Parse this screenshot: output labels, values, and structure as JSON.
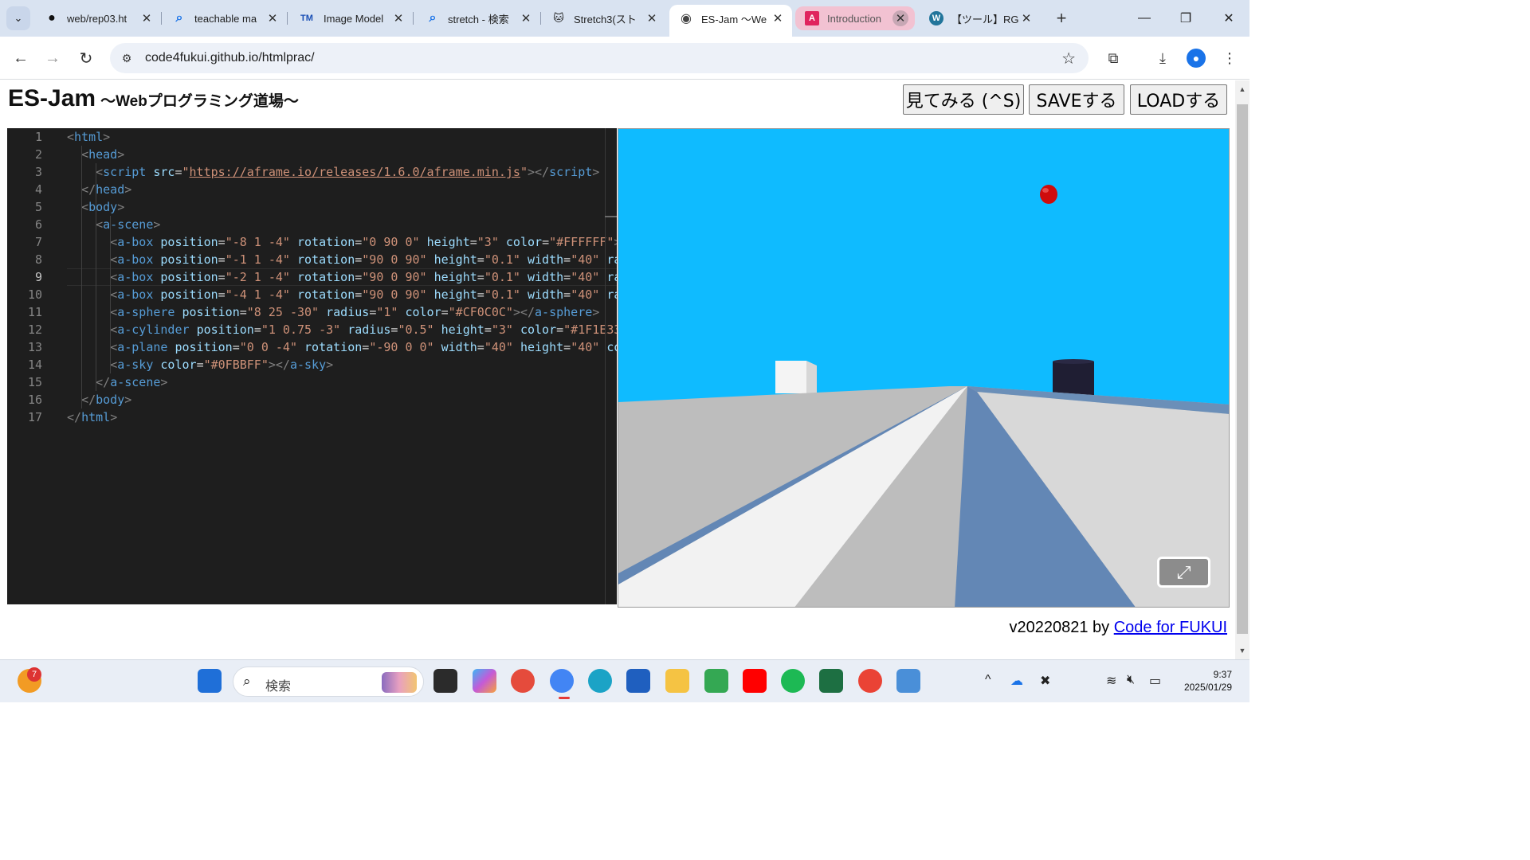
{
  "tabs": [
    {
      "title": "web/rep03.ht",
      "icon": "github-icon"
    },
    {
      "title": "teachable ma",
      "icon": "search-icon"
    },
    {
      "title": "Image Model",
      "icon": "tm-icon"
    },
    {
      "title": "stretch - 検索",
      "icon": "search-icon"
    },
    {
      "title": "Stretch3(スト",
      "icon": "scratch-cat-icon"
    },
    {
      "title": "ES-Jam 〜We",
      "icon": "globe-icon",
      "active": true
    },
    {
      "title": "Introduction",
      "icon": "angular-icon"
    },
    {
      "title": "【ツール】RGB",
      "icon": "wordpress-icon"
    }
  ],
  "tab_glyphs": {
    "github": "●",
    "search": "⌕",
    "tm": "TM",
    "scratch": "🐱",
    "globe": "◉",
    "angular": "A",
    "wordpress": "W",
    "close": "✕",
    "new_tab": "+",
    "list_tabs": "⌄",
    "minimize": "—",
    "restore": "❐",
    "close_window": "✕"
  },
  "toolbar": {
    "back": "←",
    "forward": "→",
    "reload": "↻",
    "url": "code4fukui.github.io/htmlprac/",
    "site_info": "⚙",
    "bookmark": "☆",
    "extensions": "⧉",
    "download": "⤓",
    "menu": "⋮",
    "profile": "●"
  },
  "page": {
    "title": "ES-Jam",
    "subtitle": "〜Webプログラミング道場〜",
    "buttons": {
      "view": "見てみる (^S)",
      "save": "SAVEする",
      "load": "LOADする"
    }
  },
  "editor": {
    "current_line": 9,
    "lines": [
      [
        [
          "pun",
          "<"
        ],
        [
          "tag",
          "html"
        ],
        [
          "pun",
          ">"
        ]
      ],
      [
        [
          "txt",
          "  "
        ],
        [
          "pun",
          "<"
        ],
        [
          "tag",
          "head"
        ],
        [
          "pun",
          ">"
        ]
      ],
      [
        [
          "txt",
          "    "
        ],
        [
          "pun",
          "<"
        ],
        [
          "tag",
          "script"
        ],
        [
          "txt",
          " "
        ],
        [
          "att",
          "src"
        ],
        [
          "txt",
          "="
        ],
        [
          "str",
          "\""
        ],
        [
          "url",
          "https://aframe.io/releases/1.6.0/aframe.min.js"
        ],
        [
          "str",
          "\""
        ],
        [
          "pun",
          "></"
        ],
        [
          "tag",
          "script"
        ],
        [
          "pun",
          ">"
        ]
      ],
      [
        [
          "txt",
          "  "
        ],
        [
          "pun",
          "</"
        ],
        [
          "tag",
          "head"
        ],
        [
          "pun",
          ">"
        ]
      ],
      [
        [
          "txt",
          "  "
        ],
        [
          "pun",
          "<"
        ],
        [
          "tag",
          "body"
        ],
        [
          "pun",
          ">"
        ]
      ],
      [
        [
          "txt",
          "    "
        ],
        [
          "pun",
          "<"
        ],
        [
          "tag",
          "a-scene"
        ],
        [
          "pun",
          ">"
        ]
      ],
      [
        [
          "txt",
          "      "
        ],
        [
          "pun",
          "<"
        ],
        [
          "tag",
          "a-box"
        ],
        [
          "txt",
          " "
        ],
        [
          "att",
          "position"
        ],
        [
          "txt",
          "="
        ],
        [
          "str",
          "\"-8 1 -4\""
        ],
        [
          "txt",
          " "
        ],
        [
          "att",
          "rotation"
        ],
        [
          "txt",
          "="
        ],
        [
          "str",
          "\"0 90 0\""
        ],
        [
          "txt",
          " "
        ],
        [
          "att",
          "height"
        ],
        [
          "txt",
          "="
        ],
        [
          "str",
          "\"3\""
        ],
        [
          "txt",
          " "
        ],
        [
          "att",
          "color"
        ],
        [
          "txt",
          "="
        ],
        [
          "str",
          "\"#FFFFFF\""
        ],
        [
          "pun",
          "></"
        ]
      ],
      [
        [
          "txt",
          "      "
        ],
        [
          "pun",
          "<"
        ],
        [
          "tag",
          "a-box"
        ],
        [
          "txt",
          " "
        ],
        [
          "att",
          "position"
        ],
        [
          "txt",
          "="
        ],
        [
          "str",
          "\"-1 1 -4\""
        ],
        [
          "txt",
          " "
        ],
        [
          "att",
          "rotation"
        ],
        [
          "txt",
          "="
        ],
        [
          "str",
          "\"90 0 90\""
        ],
        [
          "txt",
          " "
        ],
        [
          "att",
          "height"
        ],
        [
          "txt",
          "="
        ],
        [
          "str",
          "\"0.1\""
        ],
        [
          "txt",
          " "
        ],
        [
          "att",
          "width"
        ],
        [
          "txt",
          "="
        ],
        [
          "str",
          "\"40\""
        ],
        [
          "txt",
          " "
        ],
        [
          "att",
          "rad"
        ]
      ],
      [
        [
          "txt",
          "      "
        ],
        [
          "pun",
          "<"
        ],
        [
          "tag",
          "a-box"
        ],
        [
          "txt",
          " "
        ],
        [
          "att",
          "position"
        ],
        [
          "txt",
          "="
        ],
        [
          "str",
          "\"-2 1 -4\""
        ],
        [
          "txt",
          " "
        ],
        [
          "att",
          "rotation"
        ],
        [
          "txt",
          "="
        ],
        [
          "str",
          "\"90 0 90\""
        ],
        [
          "txt",
          " "
        ],
        [
          "att",
          "height"
        ],
        [
          "txt",
          "="
        ],
        [
          "str",
          "\"0.1\""
        ],
        [
          "txt",
          " "
        ],
        [
          "att",
          "width"
        ],
        [
          "txt",
          "="
        ],
        [
          "str",
          "\"40\""
        ],
        [
          "txt",
          " "
        ],
        [
          "att",
          "rad"
        ]
      ],
      [
        [
          "txt",
          "      "
        ],
        [
          "pun",
          "<"
        ],
        [
          "tag",
          "a-box"
        ],
        [
          "txt",
          " "
        ],
        [
          "att",
          "position"
        ],
        [
          "txt",
          "="
        ],
        [
          "str",
          "\"-4 1 -4\""
        ],
        [
          "txt",
          " "
        ],
        [
          "att",
          "rotation"
        ],
        [
          "txt",
          "="
        ],
        [
          "str",
          "\"90 0 90\""
        ],
        [
          "txt",
          " "
        ],
        [
          "att",
          "height"
        ],
        [
          "txt",
          "="
        ],
        [
          "str",
          "\"0.1\""
        ],
        [
          "txt",
          " "
        ],
        [
          "att",
          "width"
        ],
        [
          "txt",
          "="
        ],
        [
          "str",
          "\"40\""
        ],
        [
          "txt",
          " "
        ],
        [
          "att",
          "rad"
        ]
      ],
      [
        [
          "txt",
          "      "
        ],
        [
          "pun",
          "<"
        ],
        [
          "tag",
          "a-sphere"
        ],
        [
          "txt",
          " "
        ],
        [
          "att",
          "position"
        ],
        [
          "txt",
          "="
        ],
        [
          "str",
          "\"8 25 -30\""
        ],
        [
          "txt",
          " "
        ],
        [
          "att",
          "radius"
        ],
        [
          "txt",
          "="
        ],
        [
          "str",
          "\"1\""
        ],
        [
          "txt",
          " "
        ],
        [
          "att",
          "color"
        ],
        [
          "txt",
          "="
        ],
        [
          "str",
          "\"#CF0C0C\""
        ],
        [
          "pun",
          "></"
        ],
        [
          "tag",
          "a-sphere"
        ],
        [
          "pun",
          ">"
        ]
      ],
      [
        [
          "txt",
          "      "
        ],
        [
          "pun",
          "<"
        ],
        [
          "tag",
          "a-cylinder"
        ],
        [
          "txt",
          " "
        ],
        [
          "att",
          "position"
        ],
        [
          "txt",
          "="
        ],
        [
          "str",
          "\"1 0.75 -3\""
        ],
        [
          "txt",
          " "
        ],
        [
          "att",
          "radius"
        ],
        [
          "txt",
          "="
        ],
        [
          "str",
          "\"0.5\""
        ],
        [
          "txt",
          " "
        ],
        [
          "att",
          "height"
        ],
        [
          "txt",
          "="
        ],
        [
          "str",
          "\"3\""
        ],
        [
          "txt",
          " "
        ],
        [
          "att",
          "color"
        ],
        [
          "txt",
          "="
        ],
        [
          "str",
          "\"#1F1E33\""
        ]
      ],
      [
        [
          "txt",
          "      "
        ],
        [
          "pun",
          "<"
        ],
        [
          "tag",
          "a-plane"
        ],
        [
          "txt",
          " "
        ],
        [
          "att",
          "position"
        ],
        [
          "txt",
          "="
        ],
        [
          "str",
          "\"0 0 -4\""
        ],
        [
          "txt",
          " "
        ],
        [
          "att",
          "rotation"
        ],
        [
          "txt",
          "="
        ],
        [
          "str",
          "\"-90 0 0\""
        ],
        [
          "txt",
          " "
        ],
        [
          "att",
          "width"
        ],
        [
          "txt",
          "="
        ],
        [
          "str",
          "\"40\""
        ],
        [
          "txt",
          " "
        ],
        [
          "att",
          "height"
        ],
        [
          "txt",
          "="
        ],
        [
          "str",
          "\"40\""
        ],
        [
          "txt",
          " "
        ],
        [
          "att",
          "col"
        ]
      ],
      [
        [
          "txt",
          "      "
        ],
        [
          "pun",
          "<"
        ],
        [
          "tag",
          "a-sky"
        ],
        [
          "txt",
          " "
        ],
        [
          "att",
          "color"
        ],
        [
          "txt",
          "="
        ],
        [
          "str",
          "\"#0FBBFF\""
        ],
        [
          "pun",
          "></"
        ],
        [
          "tag",
          "a-sky"
        ],
        [
          "pun",
          ">"
        ]
      ],
      [
        [
          "txt",
          "    "
        ],
        [
          "pun",
          "</"
        ],
        [
          "tag",
          "a-scene"
        ],
        [
          "pun",
          ">"
        ]
      ],
      [
        [
          "txt",
          "  "
        ],
        [
          "pun",
          "</"
        ],
        [
          "tag",
          "body"
        ],
        [
          "pun",
          ">"
        ]
      ],
      [
        [
          "pun",
          "</"
        ],
        [
          "tag",
          "html"
        ],
        [
          "pun",
          ">"
        ]
      ]
    ]
  },
  "preview": {
    "sky_color": "#0fbbff",
    "sphere_color": "#cf0c0c",
    "cylinder_color": "#1f1e33",
    "fullscreen_icon": "⤢"
  },
  "footer": {
    "version": "v20220821 by ",
    "link_text": "Code for FUKUI"
  },
  "taskbar": {
    "weather_badge": "7",
    "search_placeholder": "検索",
    "search_icon": "⌕",
    "tray": {
      "chevron": "^",
      "onedrive": "☁",
      "x": "✖",
      "wifi": "≋",
      "volume": "🔇︎",
      "battery": "▭"
    },
    "time": "9:37",
    "date": "2025/01/29"
  }
}
